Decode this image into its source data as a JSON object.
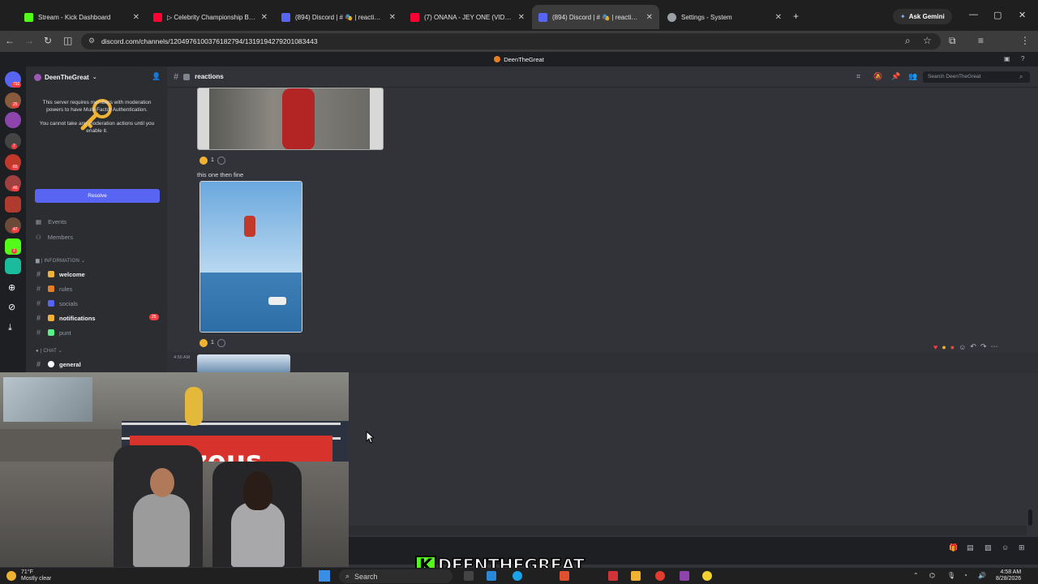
{
  "browser": {
    "tabs": [
      {
        "label": "Stream - Kick Dashboard",
        "color": "#53fc18"
      },
      {
        "label": "▷ Celebrity Championship Boxi",
        "color": "#ff0033"
      },
      {
        "label": "(894) Discord | # 🎭 | reactions",
        "color": "#5865f2"
      },
      {
        "label": "(7) ONANA - JEY ONE (VIDEO OF",
        "color": "#ff0033"
      },
      {
        "label": "(894) Discord | # 🎭 | reactions",
        "color": "#5865f2"
      },
      {
        "label": "Settings - System",
        "color": "#9aa0a6"
      }
    ],
    "ask_gemini": "Ask Gemini",
    "url": "discord.com/channels/1204976100376182794/1319194279201083443"
  },
  "discord": {
    "title": "DeenTheGreat",
    "server_name": "DeenTheGreat",
    "rail_badges": [
      "792",
      "25",
      "7",
      "65",
      "46",
      "47",
      "2"
    ],
    "mfa_notice": "This server requires members with moderation powers to have Multi-Factor Authentication.",
    "mfa_warning": "You cannot take any moderation actions until you enable it.",
    "resolve_label": "Resolve",
    "links": [
      "Events",
      "Members"
    ],
    "categories": {
      "information": "INFORMATION",
      "chat": "CHAT"
    },
    "channels": [
      {
        "name": "welcome",
        "emoji_color": "#f0b232"
      },
      {
        "name": "rules",
        "emoji_color": "#e67e22"
      },
      {
        "name": "socials",
        "emoji_color": "#5865f2"
      },
      {
        "name": "notifications",
        "emoji_color": "#f0b232"
      },
      {
        "name": "punt",
        "emoji_color": "#57f287"
      },
      {
        "name": "general",
        "emoji_color": "#ffffff"
      }
    ],
    "notifications_badge": "25",
    "channel_name": "reactions",
    "search_placeholder": "Search DeenTheGreat"
  },
  "messages": {
    "reaction_count_1": "1",
    "caption": "this one then fine",
    "reaction_count_2": "1",
    "timestamp": "4:56 AM"
  },
  "overlay": {
    "brand_letter": "K",
    "streamer_name": "DEENTHEGREAT"
  },
  "taskbar": {
    "temp": "71°F",
    "weather": "Mostly clear",
    "search": "Search",
    "time": "4:58 AM",
    "date": "8/28/2026"
  }
}
